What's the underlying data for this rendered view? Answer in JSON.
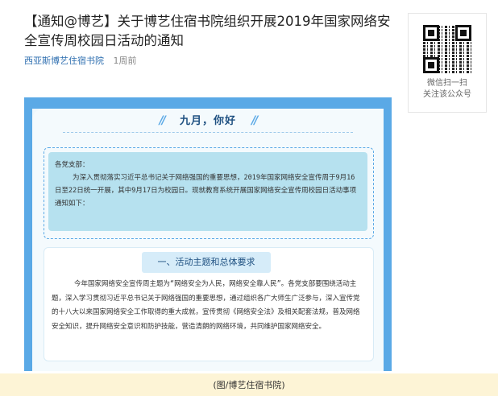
{
  "article": {
    "title": "【通知@博艺】关于博艺住宿书院组织开展2019年国家网络安全宣传周校园日活动的通知",
    "source": "西亚斯博艺住宿书院",
    "time": "1周前"
  },
  "qr": {
    "line1": "微信扫一扫",
    "line2": "关注该公众号"
  },
  "image": {
    "heading": "九月，你好",
    "notice_greeting": "各党支部：",
    "notice_body": "为深入贯彻落实习近平总书记关于网络强国的重要思想，2019年国家网络安全宣传周于9月16日至22日统一开展，其中9月17日为校园日。现就教育系统开展国家网络安全宣传周校园日活动事项通知如下：",
    "section_title": "一、活动主题和总体要求",
    "section_body": "今年国家网络安全宣传周主题为“网络安全为人民，网络安全靠人民”。各党支部要围绕活动主题，深入学习贯彻习近平总书记关于网络强国的重要思想，通过组织各广大师生广泛参与，深入宣传党的十八大以来国家网络安全工作取得的重大成就，宣传贯彻《网络安全法》及相关配套法规，普及网络安全知识，提升网络安全意识和防护技能，营造清朗的网络环境，共同维护国家网络安全。"
  },
  "caption": "(图/博艺住宿书院)"
}
